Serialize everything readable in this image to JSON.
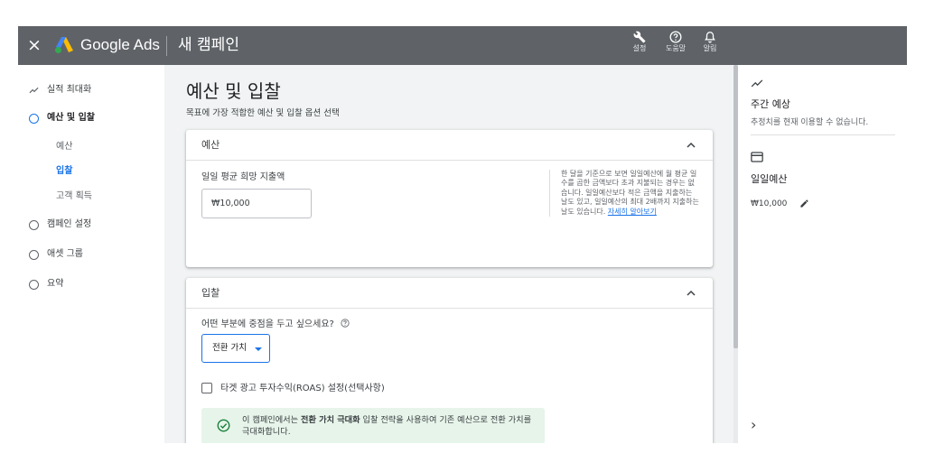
{
  "header": {
    "close_icon": "×",
    "brand": "Google Ads",
    "page_title": "새 캠페인",
    "actions": [
      {
        "icon": "wrench-icon",
        "label": "설정"
      },
      {
        "icon": "help-icon",
        "label": "도움말"
      },
      {
        "icon": "bell-icon",
        "label": "알림"
      }
    ]
  },
  "sidebar": {
    "items": [
      {
        "label": "실적 최대화",
        "icon": "trending-icon"
      },
      {
        "label": "예산 및 입찰",
        "active": true
      },
      {
        "label": "예산",
        "sub": true
      },
      {
        "label": "입찰",
        "sub": true,
        "active": true
      },
      {
        "label": "고객 획득",
        "sub": true
      },
      {
        "label": "캠페인 설정"
      },
      {
        "label": "애셋 그룹"
      },
      {
        "label": "요약"
      }
    ]
  },
  "main": {
    "title": "예산 및 입찰",
    "subtitle": "목표에 가장 적합한 예산 및 입찰 옵션 선택",
    "budget_card": {
      "title": "예산",
      "field_label": "일일 평균 희망 지출액",
      "field_value": "₩10,000",
      "help_text": "한 달을 기준으로 보면 일일예산에 월 평균 일수를 곱한 금액보다 초과 지불되는 경우는 없습니다. 일일예산보다 적은 금액을 지출하는 날도 있고, 일일예산의 최대 2배까지 지출하는 날도 있습니다. ",
      "help_link": "자세히 알아보기"
    },
    "bidding_card": {
      "title": "입찰",
      "question": "어떤 부분에 중점을 두고 싶으세요?",
      "dropdown_value": "전환 가치",
      "checkbox_label": "타겟 광고 투자수익(ROAS) 설정(선택사항)",
      "info_prefix": "이 캠페인에서는 ",
      "info_bold": "전환 가치 극대화",
      "info_suffix": " 입찰 전략을 사용하여 기존 예산으로 전환 가치를 극대화합니다."
    }
  },
  "right_panel": {
    "weekly_title": "주간 예상",
    "weekly_text": "추정치를 현재 이용할 수 없습니다.",
    "daily_title": "일일예산",
    "daily_value": "₩10,000",
    "expand_icon": "›"
  },
  "colors": {
    "topbar": "#5f6368",
    "accent": "#1a73e8",
    "info_bg": "#e6f4ea",
    "success": "#188038"
  }
}
